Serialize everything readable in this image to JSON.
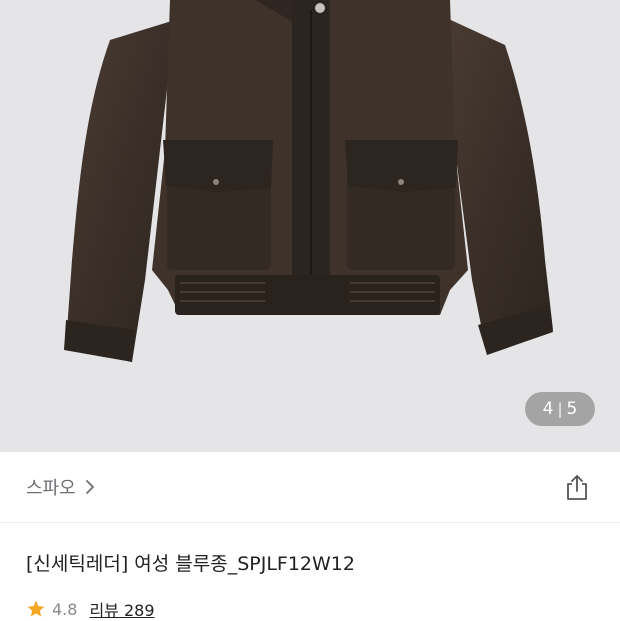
{
  "gallery": {
    "current_index": "4",
    "separator": "|",
    "total": "5"
  },
  "brand": {
    "name": "스파오",
    "chevron_icon": "chevron-right-icon"
  },
  "share": {
    "icon": "share-icon"
  },
  "product": {
    "title": "[신세틱레더] 여성 블루종_SPJLF12W12"
  },
  "rating": {
    "star_icon": "star-icon",
    "star_color": "#f5a623",
    "value": "4.8",
    "review_label": "리뷰 289"
  }
}
